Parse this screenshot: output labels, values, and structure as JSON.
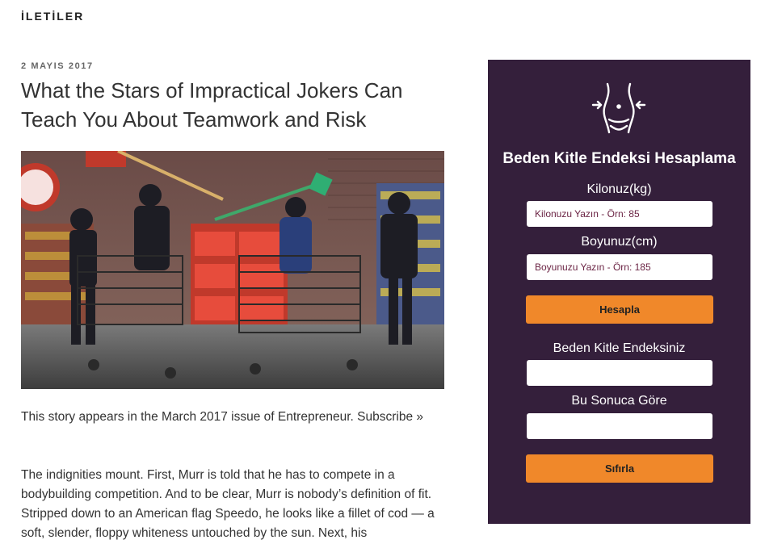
{
  "header": {
    "section_title": "İLETİLER"
  },
  "post": {
    "date": "2 MAYIS 2017",
    "title": "What the Stars of Impractical Jokers Can Teach You About Teamwork and Risk",
    "image_alt": "Impractical Jokers cast with shopping carts in a supermarket",
    "story_line_text": "This story appears in the March 2017 issue of Entrepreneur. Subscribe »",
    "body_text": "The indignities mount. First, Murr is told that he has to compete in a bodybuilding competition. And to be clear, Murr is nobody’s definition of fit. Stripped down to an American flag Speedo, he looks like a fillet of cod — a soft, slender, floppy whiteness untouched by the sun. Next, his"
  },
  "bmi_widget": {
    "icon": "waist-measure-icon",
    "title": "Beden Kitle Endeksi Hesaplama",
    "weight_label": "Kilonuz(kg)",
    "weight_placeholder": "Kilonuzu Yazın - Örn: 85",
    "height_label": "Boyunuz(cm)",
    "height_placeholder": "Boyunuzu Yazın - Örn: 185",
    "calculate_button": "Hesapla",
    "result_label": "Beden Kitle Endeksiniz",
    "result_value": "",
    "interpretation_label": "Bu Sonuca Göre",
    "interpretation_value": "",
    "reset_button": "Sıfırla"
  },
  "colors": {
    "widget_bg": "#341f3b",
    "button_bg": "#f0882a",
    "placeholder_text": "#6b2444"
  }
}
